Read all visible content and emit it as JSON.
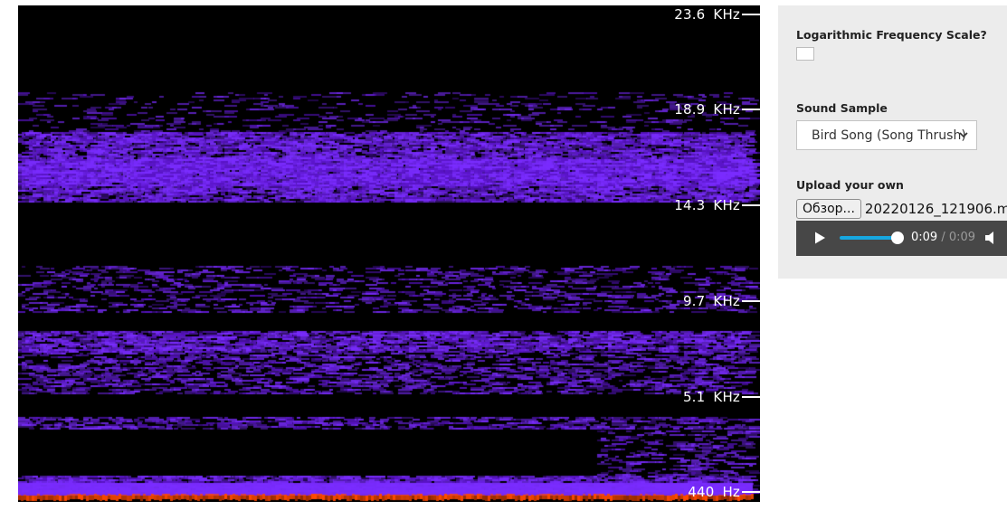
{
  "spectrogram": {
    "frequency_labels": [
      {
        "value": "23.6",
        "unit": "KHz"
      },
      {
        "value": "18.9",
        "unit": "KHz"
      },
      {
        "value": "14.3",
        "unit": "KHz"
      },
      {
        "value": "9.7",
        "unit": "KHz"
      },
      {
        "value": "5.1",
        "unit": "KHz"
      },
      {
        "value": "440",
        "unit": "Hz"
      }
    ],
    "colors": {
      "background": "#000000",
      "low": "#5a14c8",
      "mid": "#7a2cff",
      "high": "#ff4a00"
    }
  },
  "controls": {
    "log_scale_label": "Logarithmic Frequency Scale?",
    "log_scale_checked": false,
    "sound_sample_label": "Sound Sample",
    "sound_sample_selected": "Bird Song (Song Thrush)",
    "upload_label": "Upload your own",
    "file_button_label": "Обзор...",
    "file_name": "20220126_121906.m"
  },
  "audio": {
    "current_time": "0:09",
    "separator": "/",
    "duration": "0:09",
    "progress": 1.0,
    "accent_color": "#17a7e0"
  }
}
